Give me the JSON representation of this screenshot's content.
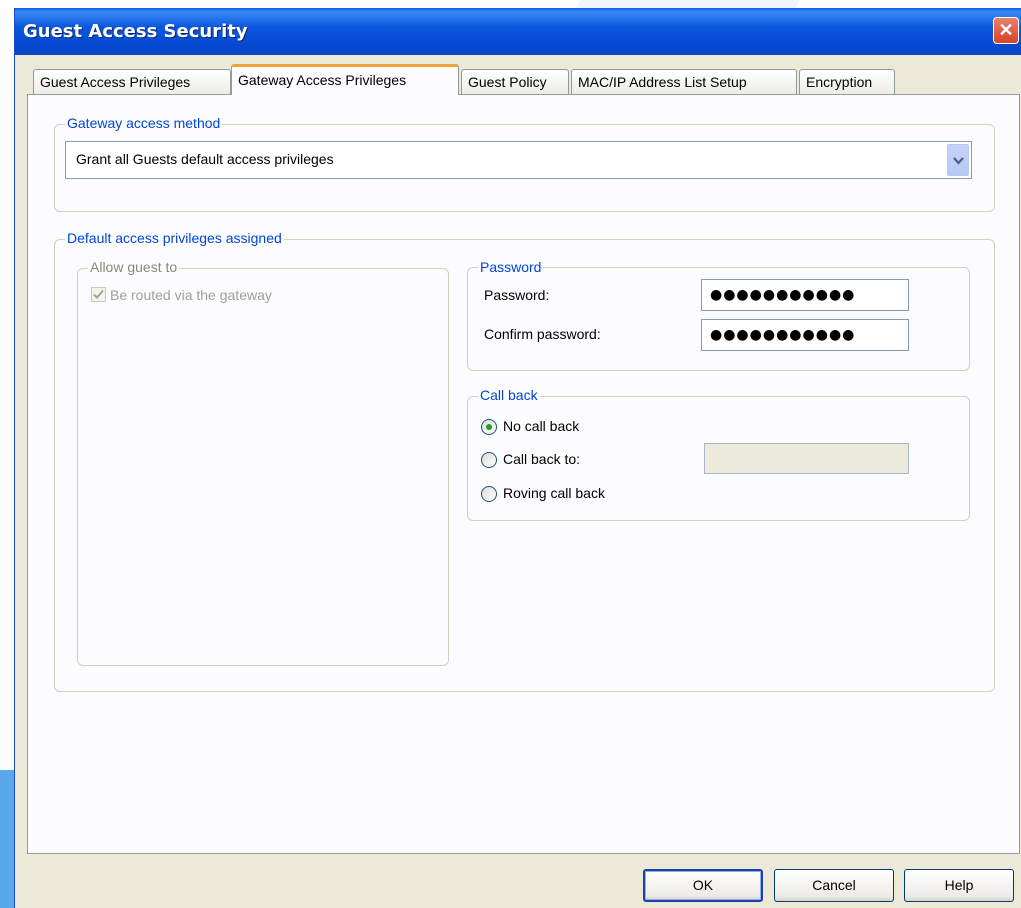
{
  "window": {
    "title": "Guest Access Security",
    "close_glyph": "✕"
  },
  "tabs": [
    {
      "label": "Guest Access Privileges",
      "active": false
    },
    {
      "label": "Gateway Access Privileges",
      "active": true
    },
    {
      "label": "Guest Policy",
      "active": false
    },
    {
      "label": "MAC/IP Address List Setup",
      "active": false
    },
    {
      "label": "Encryption",
      "active": false
    }
  ],
  "gateway_access": {
    "group_label": "Gateway access method",
    "selected": "Grant all Guests default access privileges"
  },
  "default_privileges": {
    "group_label": "Default access privileges assigned",
    "allow_guest": {
      "group_label": "Allow guest to",
      "route_via_gateway_label": "Be routed via the gateway",
      "route_via_gateway_checked": true
    },
    "password": {
      "group_label": "Password",
      "password_label": "Password:",
      "password_value": "●●●●●●●●●●●",
      "confirm_label": "Confirm password:",
      "confirm_value": "●●●●●●●●●●●"
    },
    "call_back": {
      "group_label": "Call back",
      "options": [
        {
          "label": "No call back",
          "checked": true
        },
        {
          "label": "Call back to:",
          "checked": false
        },
        {
          "label": "Roving call back",
          "checked": false
        }
      ],
      "call_back_number": ""
    }
  },
  "buttons": {
    "ok": "OK",
    "cancel": "Cancel",
    "help": "Help"
  },
  "colors": {
    "title_bar": "#0a58df",
    "group_label": "#0046d5",
    "active_tab_accent": "#f0a23a",
    "radio_dot": "#21a121"
  }
}
